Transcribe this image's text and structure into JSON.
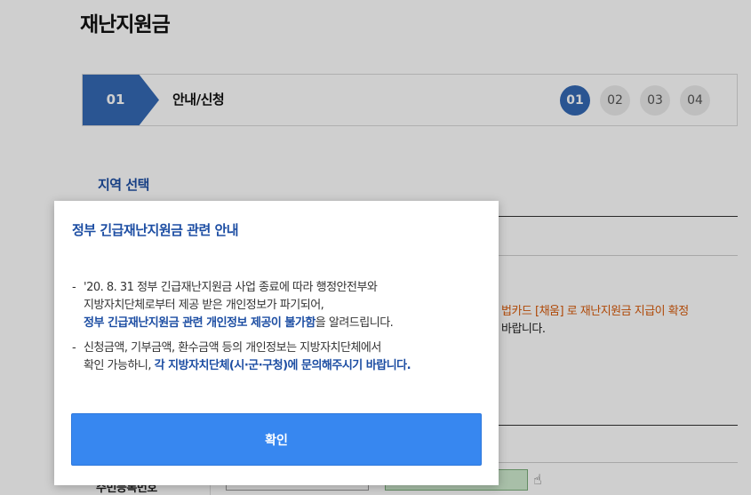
{
  "page": {
    "title": "재난지원금",
    "steps": {
      "current_num": "01",
      "current_label": "안내/신청",
      "dots": [
        "01",
        "02",
        "03",
        "04"
      ],
      "active_index": 0
    },
    "section_title": "지역 선택",
    "notice_orange": "법카드 [채움] 로 재난지원금 지급이 확정",
    "notice_dark": "바랍니다.",
    "row_label": "주민등록번호"
  },
  "modal": {
    "title": "정부 긴급재난지원금 관련 안내",
    "bullet1": {
      "line1": "'20. 8. 31 정부 긴급재난지원금 사업 종료에 따라 행정안전부와",
      "line2": "지방자치단체로부터 제공 받은 개인정보가 파기되어,",
      "line3_emphasis": "정부 긴급재난지원금 관련 개인정보 제공이 불가함",
      "line3_tail": "을 알려드립니다."
    },
    "bullet2": {
      "line1": "신청금액, 기부금액, 환수금액 등의 개인정보는 지방자치단체에서",
      "line2_head": "확인 가능하니, ",
      "line2_emphasis": "각 지방자치단체(시·군·구청)에 문의해주시기 바랍니다."
    },
    "confirm_label": "확인"
  },
  "colors": {
    "brand_blue": "#3469b4",
    "title_blue": "#1d4ea3",
    "button_blue": "#3787f0",
    "notice_orange": "#d85a0a"
  }
}
